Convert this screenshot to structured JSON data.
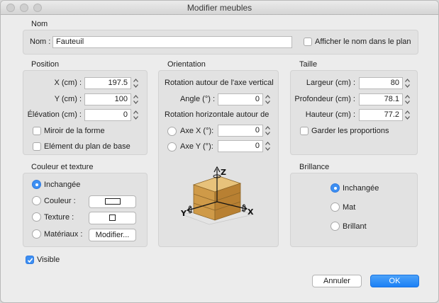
{
  "window": {
    "title": "Modifier meubles"
  },
  "name_section": {
    "title": "Nom",
    "label": "Nom :",
    "value": "Fauteuil",
    "show_name_label": "Afficher le nom dans le plan",
    "show_name_checked": false
  },
  "position": {
    "title": "Position",
    "x_label": "X (cm) :",
    "x_value": "197.5",
    "y_label": "Y (cm) :",
    "y_value": "100",
    "elevation_label": "Élévation (cm) :",
    "elevation_value": "0",
    "mirror_label": "Miroir de la forme",
    "mirror_checked": false,
    "base_plan_label": "Elément du plan de base",
    "base_plan_checked": false
  },
  "orientation": {
    "title": "Orientation",
    "vertical_heading": "Rotation autour de l'axe vertical",
    "angle_label": "Angle (°) :",
    "angle_value": "0",
    "horizontal_heading": "Rotation horizontale autour de",
    "axis_x_label": "Axe X (°):",
    "axis_x_value": "0",
    "axis_y_label": "Axe Y (°):",
    "axis_y_value": "0",
    "diagram": {
      "z": "Z",
      "x": "X",
      "y": "Y"
    }
  },
  "size": {
    "title": "Taille",
    "width_label": "Largeur (cm) :",
    "width_value": "80",
    "depth_label": "Profondeur (cm) :",
    "depth_value": "78.1",
    "height_label": "Hauteur (cm) :",
    "height_value": "77.2",
    "keep_proportions_label": "Garder les proportions",
    "keep_proportions_checked": false
  },
  "color_texture": {
    "title": "Couleur et texture",
    "unchanged_label": "Inchangée",
    "color_label": "Couleur :",
    "texture_label": "Texture :",
    "materials_label": "Matériaux :",
    "modify_button": "Modifier...",
    "selected": "unchanged"
  },
  "shininess": {
    "title": "Brillance",
    "unchanged_label": "Inchangée",
    "matte_label": "Mat",
    "shiny_label": "Brillant",
    "selected": "unchanged"
  },
  "visible": {
    "label": "Visible",
    "checked": true
  },
  "buttons": {
    "cancel": "Annuler",
    "ok": "OK"
  },
  "colors": {
    "accent": "#3d8ff2",
    "panel": "#e2e2e2",
    "window": "#ececec"
  }
}
